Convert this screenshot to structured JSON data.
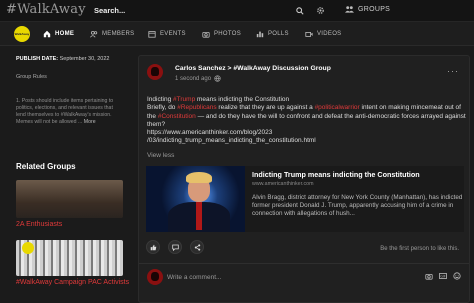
{
  "header": {
    "logo": "#WalkAway",
    "search_placeholder": "Search...",
    "groups_label": "GROUPS"
  },
  "group": {
    "avatar_text": "WalkAway"
  },
  "nav": {
    "items": [
      {
        "label": "HOME",
        "icon": "home-icon",
        "active": true
      },
      {
        "label": "MEMBERS",
        "icon": "members-icon"
      },
      {
        "label": "EVENTS",
        "icon": "calendar-icon"
      },
      {
        "label": "PHOTOS",
        "icon": "camera-icon"
      },
      {
        "label": "POLLS",
        "icon": "bar-chart-icon"
      },
      {
        "label": "VIDEOS",
        "icon": "video-icon"
      }
    ]
  },
  "sidebar": {
    "publish_label": "PUBLISH DATE:",
    "publish_date": "September 30, 2022",
    "rules_label": "Group Rules",
    "rule_text": "1. Posts should include items pertaining to politics, elections, and relevant issues that lend themselves to #WalkAway's mission. Memes will not be allowed ...",
    "rule_more": "More",
    "related_title": "Related Groups",
    "related": [
      {
        "label": "2A Enthusiasts"
      },
      {
        "label": "#WalkAway Campaign PAC Activists"
      }
    ]
  },
  "post": {
    "author": "Carlos Sanchez",
    "group": "#WalkAway Discussion Group",
    "separator": ">",
    "time": "1 second ago",
    "text_parts": [
      {
        "t": "Indicting ",
        "tag": false
      },
      {
        "t": "#Trump",
        "tag": true
      },
      {
        "t": " means indicting the Constitution",
        "tag": false
      },
      {
        "t": "\nBriefly, do ",
        "tag": false
      },
      {
        "t": "#Republicans",
        "tag": true
      },
      {
        "t": " realize that they are up against a ",
        "tag": false
      },
      {
        "t": "#politicalwarrior",
        "tag": true
      },
      {
        "t": " intent on making mincemeat out of the ",
        "tag": false
      },
      {
        "t": "#Constitution",
        "tag": true
      },
      {
        "t": " — and do they have the will to confront and defeat the anti-democratic forces arrayed against them?",
        "tag": false
      },
      {
        "t": "\nhttps://www.americanthinker.com/blog/2023\n/03/indicting_trump_means_indicting_the_constitution.html",
        "tag": false
      }
    ],
    "view_less": "View less",
    "link": {
      "title": "Indicting Trump means indicting the Constitution",
      "domain": "www.americanthinker.com",
      "description": "Alvin Bragg, district attorney for New York County (Manhattan), has indicted former president Donald J. Trump, apparently accusing him of a crime in connection with allegations of hush..."
    },
    "first_like": "Be the first person to like this.",
    "comment_placeholder": "Write a comment..."
  },
  "colors": {
    "accent": "#e03a3a",
    "group_badge": "#e8d800",
    "background": "#1b1b1b"
  }
}
